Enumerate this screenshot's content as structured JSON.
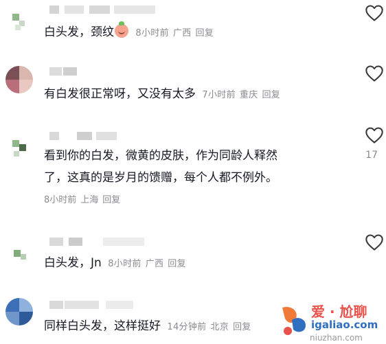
{
  "comments": [
    {
      "text": "白头发，颈纹",
      "emoji": "peach-emoji",
      "time": "8小时前",
      "location": "广西",
      "reply": "回复",
      "likes": ""
    },
    {
      "text": "有白发很正常呀，又没有太多",
      "time": "7小时前",
      "location": "重庆",
      "reply": "回复",
      "likes": ""
    },
    {
      "text_line1": "看到你的白发，微黄的皮肤，作为同龄人释然",
      "text_line2": "了，这真的是岁月的馈赠，每个人都不例外。",
      "time": "8小时前",
      "location": "上海",
      "reply": "回复",
      "likes": "17"
    },
    {
      "text": "白头发，Jn",
      "time": "8小时前",
      "location": "广西",
      "reply": "回复",
      "likes": ""
    },
    {
      "text": "同样白头发，这样挺好",
      "time": "14分钟前",
      "location": "北京",
      "reply": "回复",
      "likes": ""
    }
  ],
  "watermark": {
    "line1": "爱 · 尬聊",
    "line2": "igaliao.com",
    "line3": "niuzhan.com"
  },
  "icons": {
    "like": "heart-outline-icon"
  },
  "colors": {
    "text": "#161823",
    "meta": "#8a8b91",
    "watermark_red": "#e8524a",
    "watermark_blue": "#2e6fc0"
  }
}
